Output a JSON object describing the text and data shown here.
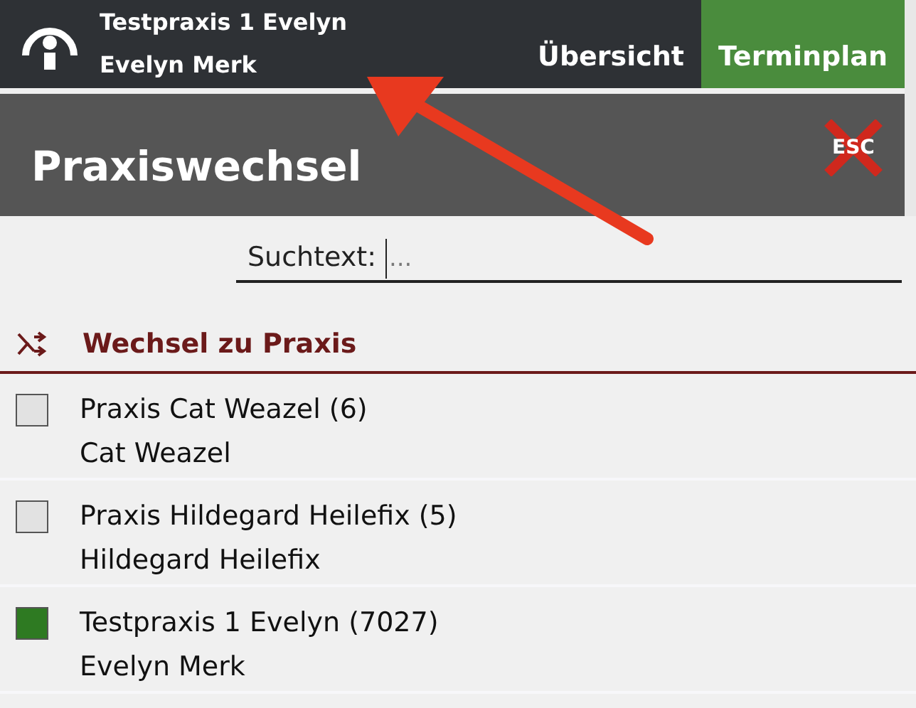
{
  "top_bar": {
    "practice": "Testpraxis 1 Evelyn",
    "user": "Evelyn Merk",
    "tabs": [
      {
        "label": "Übersicht",
        "selected": false
      },
      {
        "label": "Terminplan",
        "selected": true
      }
    ]
  },
  "header": {
    "title": "Praxiswechsel",
    "close_label": "ESC"
  },
  "search": {
    "label": "Suchtext:",
    "placeholder": "..."
  },
  "section": {
    "title": "Wechsel zu Praxis"
  },
  "practices": [
    {
      "name": "Praxis Cat Weazel (6)",
      "owner": "Cat Weazel",
      "checked": false
    },
    {
      "name": "Praxis Hildegard Heilefix (5)",
      "owner": "Hildegard Heilefix",
      "checked": false
    },
    {
      "name": "Testpraxis 1 Evelyn (7027)",
      "owner": "Evelyn Merk",
      "checked": true
    }
  ]
}
